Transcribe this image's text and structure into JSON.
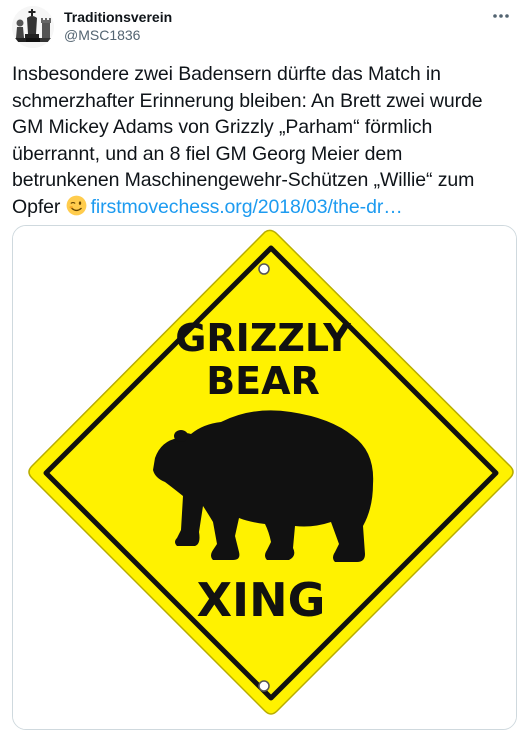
{
  "tweet": {
    "display_name": "Traditionsverein",
    "handle": "@MSC1836",
    "more_icon": "more-horizontal-icon",
    "text_before_emoji": "Insbesondere zwei Badensern dürfte das Match in schmerzhafter Erinnerung bleiben: An Brett zwei wurde GM Mickey Adams von Grizzly „Parham“ förmlich überrannt, und an 8 fiel GM Georg Meier dem betrunkenen Maschinengewehr-Schützen „Willie“ zum Opfer",
    "emoji": "winking-face-emoji",
    "link_text": "firstmovechess.org/2018/03/the-dr…"
  },
  "media": {
    "sign_line1": "GRIZZLY",
    "sign_line2": "BEAR",
    "sign_line3": "XING",
    "sign_color": "#FFF200",
    "icon": "bear-silhouette-icon"
  },
  "colors": {
    "link": "#1d9bf0",
    "text": "#0f1419",
    "secondary": "#536471",
    "border": "#cfd9de"
  }
}
